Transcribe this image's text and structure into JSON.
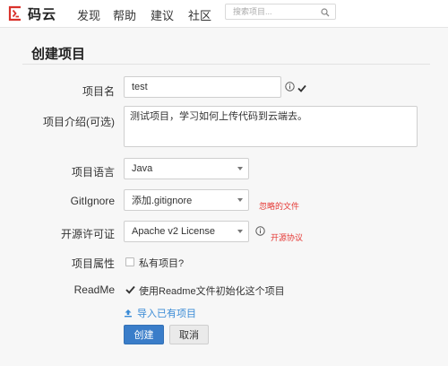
{
  "header": {
    "logo_text": "码云",
    "nav": [
      "发现",
      "帮助",
      "建议",
      "社区"
    ],
    "search_placeholder": "搜索项目..."
  },
  "form": {
    "page_title": "创建项目",
    "name": {
      "label": "项目名",
      "value": "test"
    },
    "description": {
      "label": "项目介绍(可选)",
      "value": "测试项目，学习如何上传代码到云端去。"
    },
    "language": {
      "label": "项目语言",
      "value": "Java"
    },
    "gitignore": {
      "label": "GitIgnore",
      "value": "添加.gitignore",
      "note": "忽略的文件"
    },
    "license": {
      "label": "开源许可证",
      "value": "Apache v2 License",
      "note": "开源协议"
    },
    "attribute": {
      "label": "项目属性",
      "checkbox_label": "私有项目?",
      "checked": false
    },
    "readme": {
      "label": "ReadMe",
      "checkbox_label": "使用Readme文件初始化这个项目",
      "checked": true
    },
    "import_link": "导入已有项目",
    "submit_label": "创建",
    "cancel_label": "取消"
  },
  "colors": {
    "brand_red": "#d9322b",
    "primary_blue": "#3a7dc9",
    "link_blue": "#3a8bd6",
    "note_red": "#e53935"
  }
}
